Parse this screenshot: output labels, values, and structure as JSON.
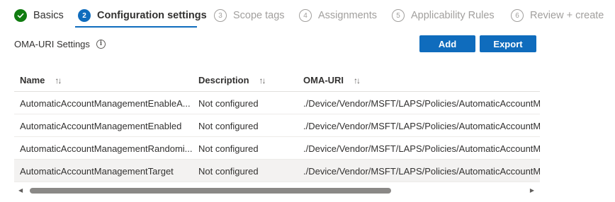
{
  "wizard": {
    "steps": [
      {
        "number": "",
        "label": "Basics",
        "state": "done"
      },
      {
        "number": "2",
        "label": "Configuration settings",
        "state": "active"
      },
      {
        "number": "3",
        "label": "Scope tags",
        "state": "future"
      },
      {
        "number": "4",
        "label": "Assignments",
        "state": "future"
      },
      {
        "number": "5",
        "label": "Applicability Rules",
        "state": "future"
      },
      {
        "number": "6",
        "label": "Review + create",
        "state": "future"
      }
    ]
  },
  "section": {
    "title": "OMA-URI Settings",
    "info_icon": "i"
  },
  "toolbar": {
    "add_label": "Add",
    "export_label": "Export"
  },
  "table": {
    "columns": [
      {
        "label": "Name",
        "sort_icon": "↑↓"
      },
      {
        "label": "Description",
        "sort_icon": "↑↓"
      },
      {
        "label": "OMA-URI",
        "sort_icon": "↑↓"
      }
    ],
    "rows": [
      {
        "name": "AutomaticAccountManagementEnableA...",
        "description": "Not configured",
        "oma_uri": "./Device/Vendor/MSFT/LAPS/Policies/AutomaticAccountM"
      },
      {
        "name": "AutomaticAccountManagementEnabled",
        "description": "Not configured",
        "oma_uri": "./Device/Vendor/MSFT/LAPS/Policies/AutomaticAccountM"
      },
      {
        "name": "AutomaticAccountManagementRandomi...",
        "description": "Not configured",
        "oma_uri": "./Device/Vendor/MSFT/LAPS/Policies/AutomaticAccountM"
      },
      {
        "name": "AutomaticAccountManagementTarget",
        "description": "Not configured",
        "oma_uri": "./Device/Vendor/MSFT/LAPS/Policies/AutomaticAccountM"
      }
    ]
  },
  "scrollbar": {
    "left_arrow": "◀",
    "right_arrow": "▶"
  },
  "colors": {
    "accent": "#0f6cbd",
    "success": "#107c10",
    "disabled_text": "#a19f9d",
    "row_highlight": "#f3f2f1"
  }
}
